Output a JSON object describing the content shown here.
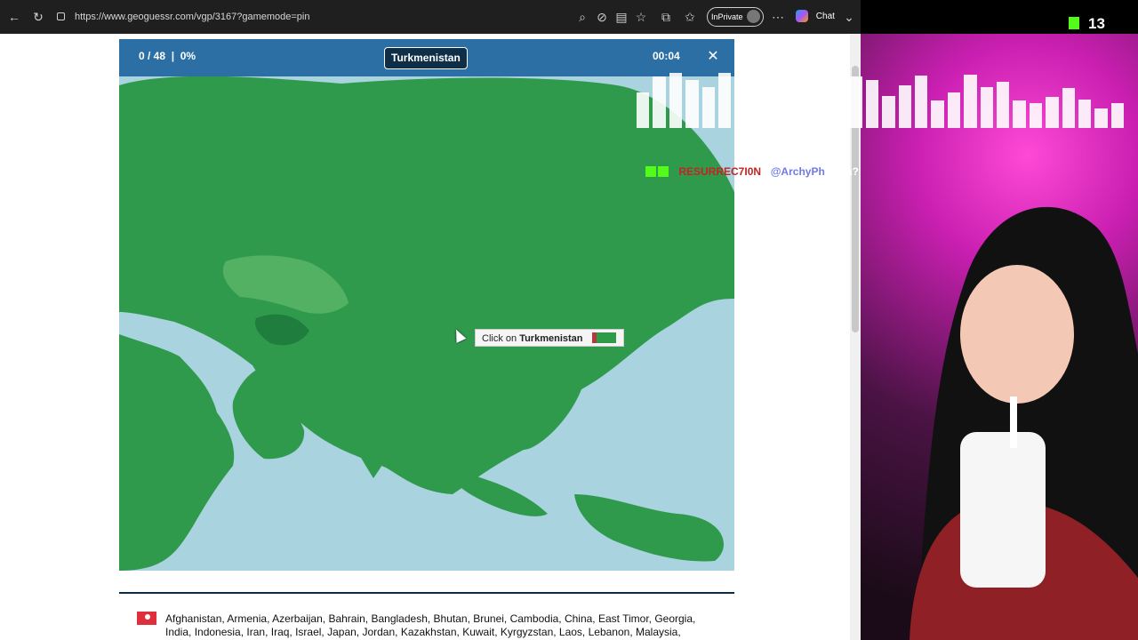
{
  "browser": {
    "url": "https://www.geoguessr.com/vgp/3167?gamemode=pin",
    "inprivate_label": "InPrivate",
    "chat_label": "Chat"
  },
  "game": {
    "score": "0 / 48",
    "percent": "0%",
    "target_country": "Turkmenistan",
    "timer": "00:04",
    "close_label": "✕",
    "tooltip_prefix": "Click on",
    "tooltip_country": "Turkmenistan",
    "countries_line1": "Afghanistan, Armenia, Azerbaijan, Bahrain, Bangladesh, Bhutan, Brunei, Cambodia, China, East Timor, Georgia,",
    "countries_line2": "India, Indonesia, Iran, Iraq, Israel, Japan, Jordan, Kazakhstan, Kuwait, Kyrgyzstan, Laos, Lebanon, Malaysia,"
  },
  "stream": {
    "viewer_count": "13",
    "chat_user": "RESURREC7I0N",
    "chat_separator": ":",
    "chat_mention": "@ArchyPh",
    "chat_text": "mzta?"
  },
  "colors": {
    "map_land": "#2f9a4c",
    "map_water": "#a9d3df",
    "highlight_region": "#53b163",
    "header_blue": "#2b6fa4"
  }
}
